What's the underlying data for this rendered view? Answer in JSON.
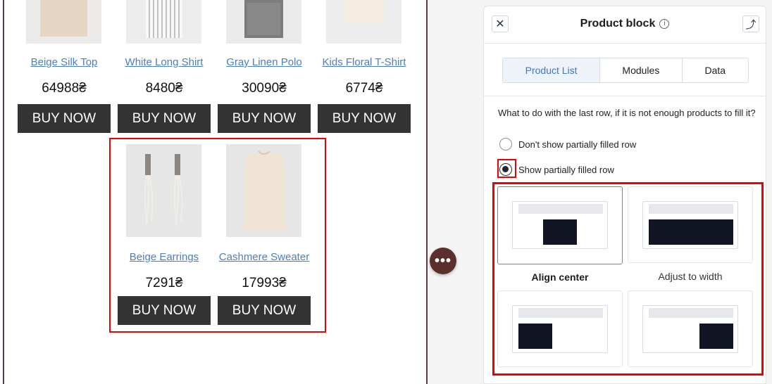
{
  "email_preview": {
    "products_row1": [
      {
        "name": "Beige Silk Top",
        "price": "64988₴",
        "button": "BUY NOW",
        "image_color": "#e8d9c8"
      },
      {
        "name": "White Long Shirt",
        "price": "8480₴",
        "button": "BUY NOW",
        "image_color": "#f1f1f1"
      },
      {
        "name": "Gray Linen Polo",
        "price": "30090₴",
        "button": "BUY NOW",
        "image_color": "#8a8a8a"
      },
      {
        "name": "Kids Floral T-Shirt",
        "price": "6774₴",
        "button": "BUY NOW",
        "image_color": "#f3e9df"
      }
    ],
    "products_row2": [
      {
        "name": "Beige Earrings",
        "price": "7291₴",
        "button": "BUY NOW",
        "image_color": "#e8e0d8"
      },
      {
        "name": "Cashmere Sweater",
        "price": "17993₴",
        "button": "BUY NOW",
        "image_color": "#efe3d4"
      }
    ],
    "more_button": "•••"
  },
  "panel": {
    "title": "Product block",
    "info_icon": "i",
    "close_icon": "✕",
    "back_icon": "⤴",
    "tabs": [
      {
        "label": "Product List",
        "active": true
      },
      {
        "label": "Modules",
        "active": false
      },
      {
        "label": "Data",
        "active": false
      }
    ],
    "question": "What to do with the last row, if it is not enough products to fill it?",
    "radios": [
      {
        "label": "Don't show partially filled row",
        "checked": false
      },
      {
        "label": "Show partially filled row",
        "checked": true
      }
    ],
    "layout_options": [
      {
        "label": "Align center",
        "selected": true
      },
      {
        "label": "Adjust to width",
        "selected": false
      },
      {
        "label": "",
        "selected": false
      },
      {
        "label": "",
        "selected": false
      }
    ]
  },
  "colors": {
    "accent": "#3a78c3",
    "highlight": "#e00000",
    "buy_button": "#333333",
    "more_button": "#5b2f2b"
  }
}
